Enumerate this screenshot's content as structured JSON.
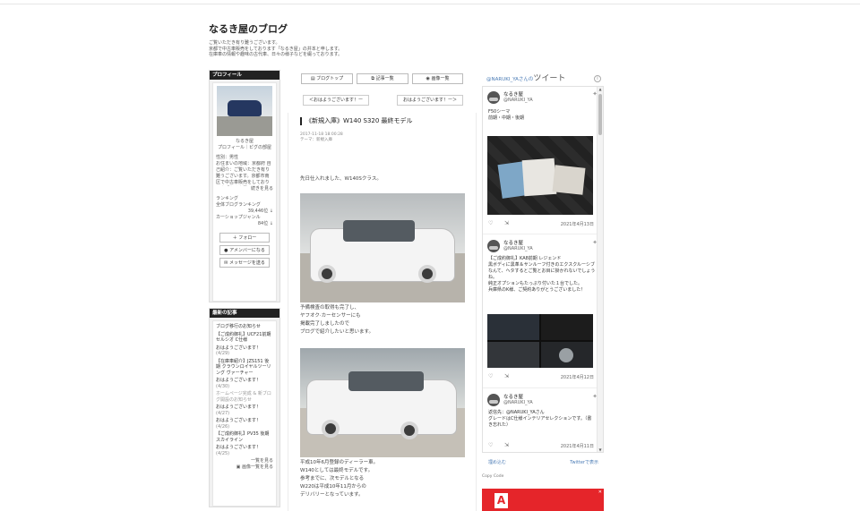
{
  "header": {
    "title": "なるき屋のブログ",
    "desc": [
      "ご覧いただき有り難うございます。",
      "京都で中古車販売をしております「なるき屋」の井本と申します。",
      "在庫車の情報や趣味の古代車、日々の様子などを綴っております。"
    ]
  },
  "sidebar": {
    "profile": {
      "heading": "プロフィール",
      "name": "なるき屋",
      "links": "プロフィール｜ピグの部屋",
      "gender": "性別：男性",
      "bio": "お住まいの地域：京都府 自己紹介：ご覧いただき有り難うございます。京都市南区で中古車販売をしております「なるき屋」と申します。",
      "more": "続きを見る",
      "ranking_label": "ランキング",
      "ranking_all_label": "全体ブログランキング",
      "ranking_all_value": "39,446位 ↓",
      "ranking_genre_label": "カーショップジャンル",
      "ranking_genre_value": "84位 ↓",
      "follow": "フォロー",
      "member": "アメンバーになる",
      "message": "メッセージを送る"
    },
    "recent": {
      "heading": "最新の記事",
      "items": [
        {
          "title": "ブログ移行のお知らせ",
          "date": ""
        },
        {
          "title": "【ご成約御礼】UCF21前期セルシオ C仕様",
          "date": ""
        },
        {
          "title": "おはようございます！",
          "date": "(4/29)"
        },
        {
          "title": "【在庫車紹介】JZS151 後期 クラウンロイヤルツーリング ヴァーチャー",
          "date": ""
        },
        {
          "title": "おはようございます！",
          "date": "(4/30)"
        },
        {
          "title": "ホームページ完成 & 新ブログ開設のお知らせ",
          "date": "",
          "dim": true
        },
        {
          "title": "おはようございます！",
          "date": "(4/27)"
        },
        {
          "title": "おはようございます！",
          "date": "(4/26)"
        },
        {
          "title": "【ご成約御礼】PV35 後期 スカイライン",
          "date": ""
        },
        {
          "title": "おはようございます！",
          "date": "(4/25)"
        }
      ],
      "more": "一覧を見る",
      "more_img": "画像一覧を見る"
    }
  },
  "nav": {
    "top": "ブログトップ",
    "list": "記事一覧",
    "images": "画像一覧",
    "prev": "＜おはようございます！ー",
    "next": "おはようございます！ー＞"
  },
  "article": {
    "title": "《新規入庫》W140 S320 最終モデル",
    "date": "2017-11-18 18:00:28",
    "theme": "テーマ：新規入庫",
    "p1": "先日仕入れました、W140Sクラス。",
    "p2": [
      "予備検査の取得も完了し、",
      "ヤフオク·カーセンサーにも",
      "掲載完了しましたので",
      "ブログで紹介したいと思います。"
    ],
    "p3": [
      "平成10年6月登録のディーラー車。",
      "W140としては最終モデルです。",
      "参考までに、次モデルとなる",
      "W220は平成10年11月からの",
      "デリバリーとなっています。"
    ]
  },
  "twitter": {
    "head_handle": "@NARUKI_YAさんの",
    "head_word": "ツイート",
    "info": "i",
    "tweets": [
      {
        "name": "なるき屋",
        "handle": "@NARUKI_YA",
        "text": [
          "F50シーマ",
          "前期・中期・後期"
        ],
        "date": "2021年4月13日"
      },
      {
        "name": "なるき屋",
        "handle": "@NARUKI_YA",
        "text": [
          "【ご成約御礼】KA8前期 レジェンド",
          "黒ボディに黒革＆サンルーフ付きのエクスクルーシブなんて、ヘタするとご覧とお目に掛かれないでしょうね。",
          "純正オプションもたっぷり付いた１台でした。",
          "兵庫県のK様、ご契約ありがとうございました！"
        ],
        "date": "2021年4月12日"
      },
      {
        "name": "なるき屋",
        "handle": "@NARUKI_YA",
        "text": [
          "返信先：@NARUKI_YAさん",
          "グレードはC仕様インテリアセレクションです。（書き忘れた）"
        ],
        "date": "2021年4月11日"
      }
    ],
    "embed": "埋め込む",
    "view_on": "Twitterで表示",
    "copy": "Copy Code"
  },
  "ad": {
    "close": "✕"
  }
}
